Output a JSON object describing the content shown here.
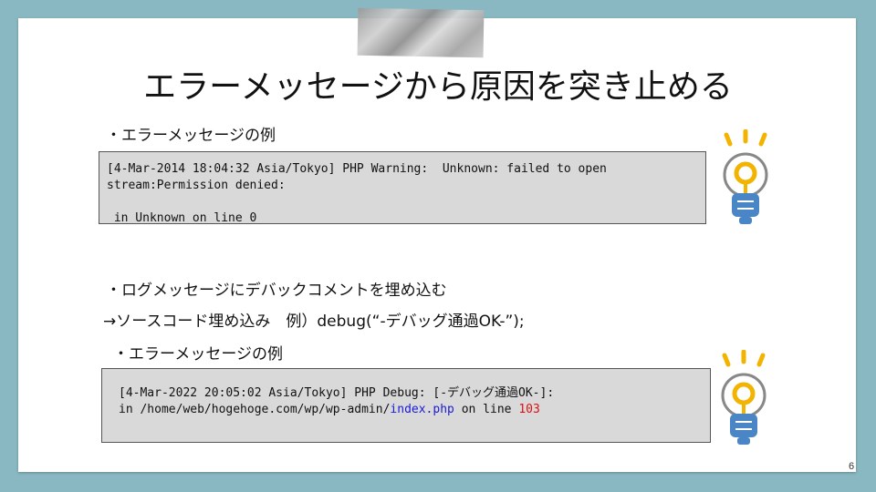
{
  "slide": {
    "title": "エラーメッセージから原因を突き止める",
    "page_number": "6"
  },
  "section1": {
    "bullet": "・エラーメッセージの例",
    "code_line1": "[4-Mar-2014 18:04:32 Asia/Tokyo] PHP Warning:  Unknown: failed to open",
    "code_line2": "stream:Permission denied:",
    "code_line3": " in Unknown on line 0"
  },
  "section2": {
    "bullet1": "・ログメッセージにデバックコメントを埋め込む",
    "bullet2": "→ソースコード埋め込み　例）debug(“-デバッグ通過OK-”);",
    "bullet3": "・エラーメッセージの例",
    "code_line1": "[4-Mar-2022 20:05:02 Asia/Tokyo] PHP Debug: [-デバッグ通過OK-]:",
    "code_line2_prefix": "in /home/web/hogehoge.com/wp/wp-admin/",
    "code_line2_file": "index.php",
    "code_line2_mid": " on line ",
    "code_line2_line": "103"
  },
  "colors": {
    "background": "#8ab8c2",
    "code_box": "#d9d9d9",
    "file_highlight": "#1a1ad6",
    "line_highlight": "#e01010",
    "bulb_glow": "#f2b400",
    "bulb_base": "#4a86c5"
  },
  "icons": [
    "lightbulb-icon",
    "lightbulb-icon"
  ]
}
